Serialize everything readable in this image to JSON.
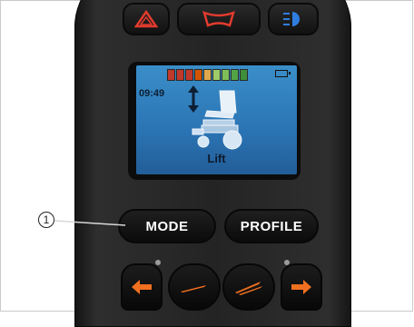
{
  "screen": {
    "time": "09:49",
    "mode": "Lift",
    "battery_bar_colors": [
      "#c0392b",
      "#c0392b",
      "#c0392b",
      "#d35400",
      "#e0a84c",
      "#9ecb6a",
      "#7fbf5a",
      "#52a447",
      "#3f8f3a"
    ]
  },
  "buttons": {
    "mode_label": "MODE",
    "profile_label": "PROFILE"
  },
  "callout": {
    "number": "1"
  },
  "colors": {
    "accent_orange": "#f07020",
    "hazard_red": "#e23b2e",
    "light_blue": "#2f7de0"
  }
}
